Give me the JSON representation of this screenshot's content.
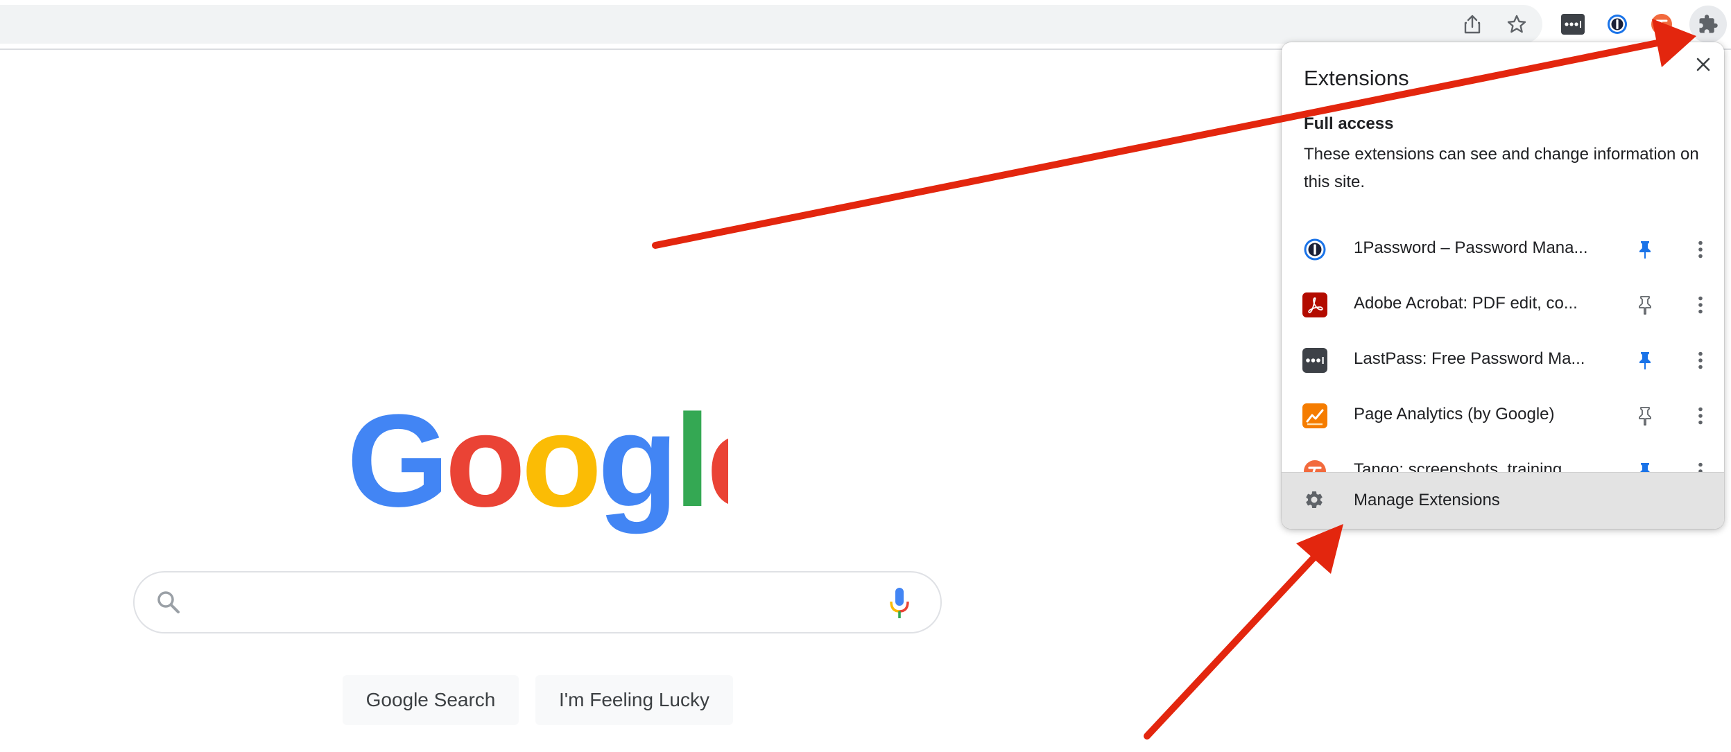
{
  "colors": {
    "pin_active": "#1a73e8",
    "annotation_arrow": "#e3260e"
  },
  "toolbar": {
    "icons": [
      "share-icon",
      "bookmark-star-icon",
      "lastpass-icon",
      "1password-icon",
      "tango-icon",
      "extensions-puzzle-icon"
    ]
  },
  "google": {
    "logo_text": "Google",
    "search_value": "",
    "search_button": "Google Search",
    "lucky_button": "I'm Feeling Lucky"
  },
  "extensions_popup": {
    "title": "Extensions",
    "section_title": "Full access",
    "section_description": "These extensions can see and change information on this site.",
    "items": [
      {
        "name": "1Password – Password Mana...",
        "icon": "1password-icon",
        "pinned": true
      },
      {
        "name": "Adobe Acrobat: PDF edit, co...",
        "icon": "adobe-acrobat-icon",
        "pinned": false
      },
      {
        "name": "LastPass: Free Password Ma...",
        "icon": "lastpass-icon",
        "pinned": true
      },
      {
        "name": "Page Analytics (by Google)",
        "icon": "page-analytics-icon",
        "pinned": false
      },
      {
        "name": "Tango: screenshots, training,...",
        "icon": "tango-icon",
        "pinned": true
      }
    ],
    "manage_label": "Manage Extensions"
  }
}
